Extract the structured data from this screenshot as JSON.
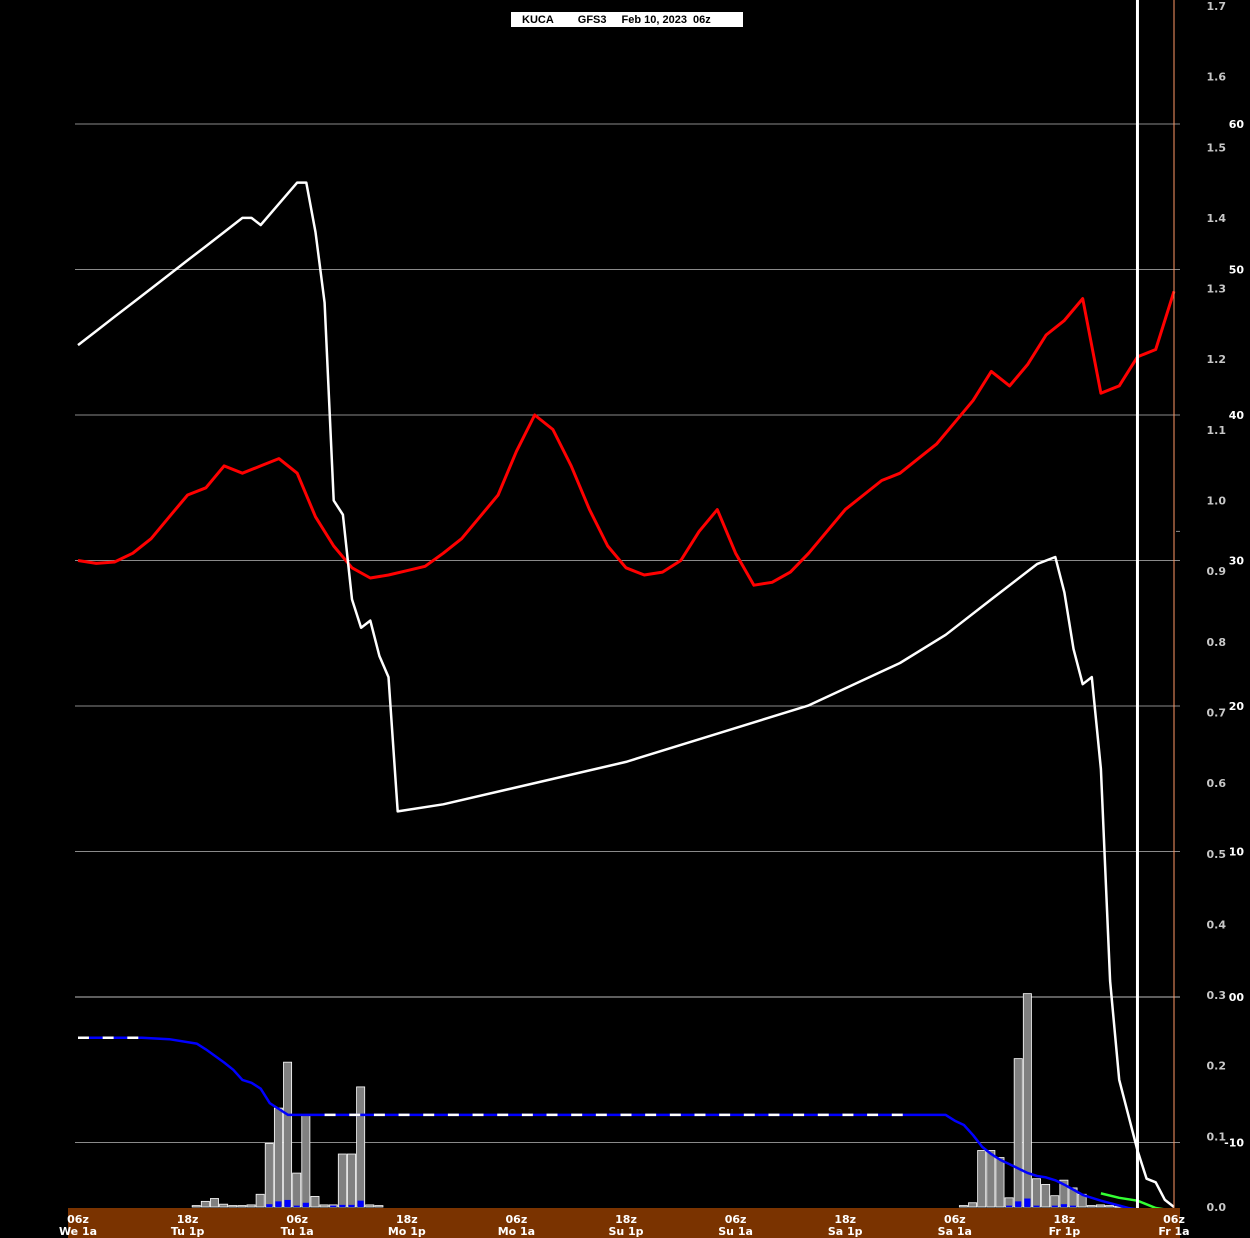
{
  "header": {
    "station": "KUCA",
    "model": "GFS3",
    "run": "Feb 10, 2023  06z"
  },
  "colors": {
    "background": "#000000",
    "temperature": "#ff0000",
    "snow_depth": "#ffffff",
    "liquid_accum": "#0000ff",
    "precip_bar": "#808080",
    "precip_bar_blue": "#0000ff",
    "green_line": "#33ff33",
    "time_axis_bg": "#7a3300",
    "now_marker": "#ff9966"
  },
  "chart_data": {
    "type": "line",
    "time_axis": {
      "orientation": "reversed (latest on left, Feb 10 06z on right)",
      "ticks": [
        {
          "hour": "06z",
          "day": "We 1a"
        },
        {
          "hour": "18z",
          "day": "Tu 1p"
        },
        {
          "hour": "06z",
          "day": "Tu 1a"
        },
        {
          "hour": "18z",
          "day": "Mo 1p"
        },
        {
          "hour": "06z",
          "day": "Mo 1a"
        },
        {
          "hour": "18z",
          "day": "Su 1p"
        },
        {
          "hour": "06z",
          "day": "Su 1a"
        },
        {
          "hour": "18z",
          "day": "Sa 1p"
        },
        {
          "hour": "06z",
          "day": "Sa 1a"
        },
        {
          "hour": "18z",
          "day": "Fr 1p"
        },
        {
          "hour": "06z",
          "day": "Fr 1a"
        }
      ],
      "range_hours": [
        120,
        0
      ]
    },
    "right_axis_precip": {
      "ylim": [
        0.0,
        1.7
      ],
      "ticks": [
        "0.0",
        "0.1",
        "0.2",
        "0.3",
        "0.4",
        "0.5",
        "0.6",
        "0.7",
        "0.8",
        "0.9",
        "1.0",
        "1.1",
        "1.2",
        "1.3",
        "1.4",
        "1.5",
        "1.6",
        "1.7"
      ]
    },
    "right_axis_temp": {
      "ylim": [
        -15,
        70
      ],
      "ticks": [
        "-10",
        "00",
        "10",
        "20",
        "30",
        "40",
        "50",
        "60"
      ],
      "gridlines": [
        -10,
        0,
        10,
        20,
        30,
        40,
        50,
        60
      ]
    },
    "series": [
      {
        "key": "temperature",
        "axis": "temp",
        "points": [
          [
            120,
            30.0
          ],
          [
            118,
            29.8
          ],
          [
            116,
            29.9
          ],
          [
            114,
            30.5
          ],
          [
            112,
            31.5
          ],
          [
            110,
            33.0
          ],
          [
            108,
            34.5
          ],
          [
            106,
            35.0
          ],
          [
            104,
            36.5
          ],
          [
            102,
            36.0
          ],
          [
            100,
            36.5
          ],
          [
            98,
            37.0
          ],
          [
            96,
            36.0
          ],
          [
            94,
            33.0
          ],
          [
            92,
            31.0
          ],
          [
            90,
            29.5
          ],
          [
            88,
            28.8
          ],
          [
            86,
            29.0
          ],
          [
            84,
            29.3
          ],
          [
            82,
            29.6
          ],
          [
            80,
            30.5
          ],
          [
            78,
            31.5
          ],
          [
            76,
            33.0
          ],
          [
            74,
            34.5
          ],
          [
            72,
            37.5
          ],
          [
            70,
            40.0
          ],
          [
            68,
            39.0
          ],
          [
            66,
            36.5
          ],
          [
            64,
            33.5
          ],
          [
            62,
            31.0
          ],
          [
            60,
            29.5
          ],
          [
            58,
            29.0
          ],
          [
            56,
            29.2
          ],
          [
            54,
            30.0
          ],
          [
            52,
            32.0
          ],
          [
            50,
            33.5
          ],
          [
            48,
            30.5
          ],
          [
            46,
            28.3
          ],
          [
            44,
            28.5
          ],
          [
            42,
            29.2
          ],
          [
            40,
            30.5
          ],
          [
            38,
            32.0
          ],
          [
            36,
            33.5
          ],
          [
            34,
            34.5
          ],
          [
            32,
            35.5
          ],
          [
            30,
            36.0
          ],
          [
            28,
            37.0
          ],
          [
            26,
            38.0
          ],
          [
            24,
            39.5
          ],
          [
            22,
            41.0
          ],
          [
            20,
            43.0
          ],
          [
            18,
            42.0
          ],
          [
            16,
            43.5
          ],
          [
            14,
            45.5
          ],
          [
            12,
            46.5
          ],
          [
            10,
            48.0
          ],
          [
            8,
            41.5
          ],
          [
            6,
            42.0
          ],
          [
            4,
            44.0
          ],
          [
            2,
            44.5
          ],
          [
            0,
            48.5
          ]
        ]
      },
      {
        "key": "snow_depth",
        "axis": "precip",
        "points": [
          [
            120,
            1.22
          ],
          [
            118,
            1.24
          ],
          [
            116,
            1.26
          ],
          [
            114,
            1.28
          ],
          [
            112,
            1.3
          ],
          [
            110,
            1.32
          ],
          [
            108,
            1.34
          ],
          [
            106,
            1.36
          ],
          [
            104,
            1.38
          ],
          [
            102,
            1.4
          ],
          [
            101,
            1.4
          ],
          [
            100,
            1.39
          ],
          [
            98,
            1.42
          ],
          [
            96,
            1.45
          ],
          [
            95,
            1.45
          ],
          [
            94,
            1.38
          ],
          [
            93,
            1.28
          ],
          [
            92,
            1.0
          ],
          [
            91,
            0.98
          ],
          [
            90,
            0.86
          ],
          [
            89,
            0.82
          ],
          [
            88,
            0.83
          ],
          [
            87,
            0.78
          ],
          [
            86,
            0.75
          ],
          [
            85,
            0.56
          ],
          [
            80,
            0.57
          ],
          [
            70,
            0.6
          ],
          [
            60,
            0.63
          ],
          [
            50,
            0.67
          ],
          [
            40,
            0.71
          ],
          [
            30,
            0.77
          ],
          [
            25,
            0.81
          ],
          [
            20,
            0.86
          ],
          [
            15,
            0.91
          ],
          [
            13,
            0.92
          ],
          [
            12,
            0.87
          ],
          [
            11,
            0.79
          ],
          [
            10,
            0.74
          ],
          [
            9,
            0.75
          ],
          [
            8,
            0.62
          ],
          [
            7,
            0.32
          ],
          [
            6,
            0.18
          ],
          [
            4,
            0.08
          ],
          [
            3,
            0.04
          ],
          [
            2,
            0.035
          ],
          [
            1,
            0.01
          ],
          [
            0,
            0.0
          ]
        ]
      },
      {
        "key": "liquid_accum",
        "axis": "temp",
        "points": [
          [
            120,
            -2.8
          ],
          [
            113,
            -2.8
          ],
          [
            110,
            -2.9
          ],
          [
            107,
            -3.2
          ],
          [
            106,
            -3.6
          ],
          [
            104,
            -4.5
          ],
          [
            103,
            -5.0
          ],
          [
            102,
            -5.7
          ],
          [
            101,
            -5.9
          ],
          [
            100,
            -6.3
          ],
          [
            99,
            -7.3
          ],
          [
            98,
            -7.7
          ],
          [
            97,
            -8.1
          ],
          [
            96,
            -8.1
          ],
          [
            94,
            -8.1
          ],
          [
            50,
            -8.1
          ],
          [
            30,
            -8.1
          ],
          [
            25,
            -8.1
          ],
          [
            24,
            -8.5
          ],
          [
            23,
            -8.8
          ],
          [
            22,
            -9.5
          ],
          [
            21,
            -10.3
          ],
          [
            20,
            -10.8
          ],
          [
            19,
            -11.2
          ],
          [
            18,
            -11.5
          ],
          [
            17,
            -11.8
          ],
          [
            16,
            -12.1
          ],
          [
            15,
            -12.3
          ],
          [
            14,
            -12.4
          ],
          [
            13,
            -12.6
          ],
          [
            12,
            -12.9
          ],
          [
            10,
            -13.6
          ],
          [
            8,
            -14.0
          ],
          [
            5,
            -14.5
          ],
          [
            2,
            -14.8
          ],
          [
            0,
            -14.9
          ]
        ]
      },
      {
        "key": "green_line",
        "axis": "temp",
        "points": [
          [
            8,
            -13.5
          ],
          [
            6,
            -13.8
          ],
          [
            4,
            -14.0
          ],
          [
            2,
            -14.5
          ],
          [
            0,
            -14.7
          ]
        ]
      }
    ],
    "bars": {
      "axis": "precip",
      "gray": [
        [
          107,
          0.002
        ],
        [
          106,
          0.008
        ],
        [
          105,
          0.012
        ],
        [
          104,
          0.004
        ],
        [
          103,
          0.002
        ],
        [
          102,
          0.002
        ],
        [
          101,
          0.003
        ],
        [
          100,
          0.018
        ],
        [
          99,
          0.09
        ],
        [
          98,
          0.14
        ],
        [
          97,
          0.205
        ],
        [
          96,
          0.048
        ],
        [
          95,
          0.13
        ],
        [
          94,
          0.015
        ],
        [
          93,
          0.003
        ],
        [
          92,
          0.003
        ],
        [
          91,
          0.075
        ],
        [
          90,
          0.075
        ],
        [
          89,
          0.17
        ],
        [
          88,
          0.003
        ],
        [
          87,
          0.002
        ],
        [
          23,
          0.002
        ],
        [
          22,
          0.006
        ],
        [
          21,
          0.08
        ],
        [
          20,
          0.08
        ],
        [
          19,
          0.07
        ],
        [
          18,
          0.013
        ],
        [
          17,
          0.21
        ],
        [
          16,
          0.302
        ],
        [
          15,
          0.04
        ],
        [
          14,
          0.032
        ],
        [
          13,
          0.016
        ],
        [
          12,
          0.038
        ],
        [
          11,
          0.027
        ],
        [
          10,
          0.018
        ],
        [
          9,
          0.002
        ],
        [
          8,
          0.003
        ],
        [
          7,
          0.002
        ],
        [
          6,
          0.001
        ]
      ],
      "blue": [
        [
          99,
          0.004
        ],
        [
          98,
          0.008
        ],
        [
          97,
          0.01
        ],
        [
          96,
          0.002
        ],
        [
          95,
          0.006
        ],
        [
          92,
          0.002
        ],
        [
          91,
          0.003
        ],
        [
          90,
          0.003
        ],
        [
          89,
          0.009
        ],
        [
          18,
          0.002
        ],
        [
          17,
          0.008
        ],
        [
          16,
          0.012
        ],
        [
          15,
          0.002
        ],
        [
          13,
          0.002
        ],
        [
          12,
          0.004
        ],
        [
          11,
          0.002
        ]
      ]
    },
    "markers": {
      "vertical_white_at_hour": 4,
      "vertical_orange_at_hour": 0
    }
  }
}
